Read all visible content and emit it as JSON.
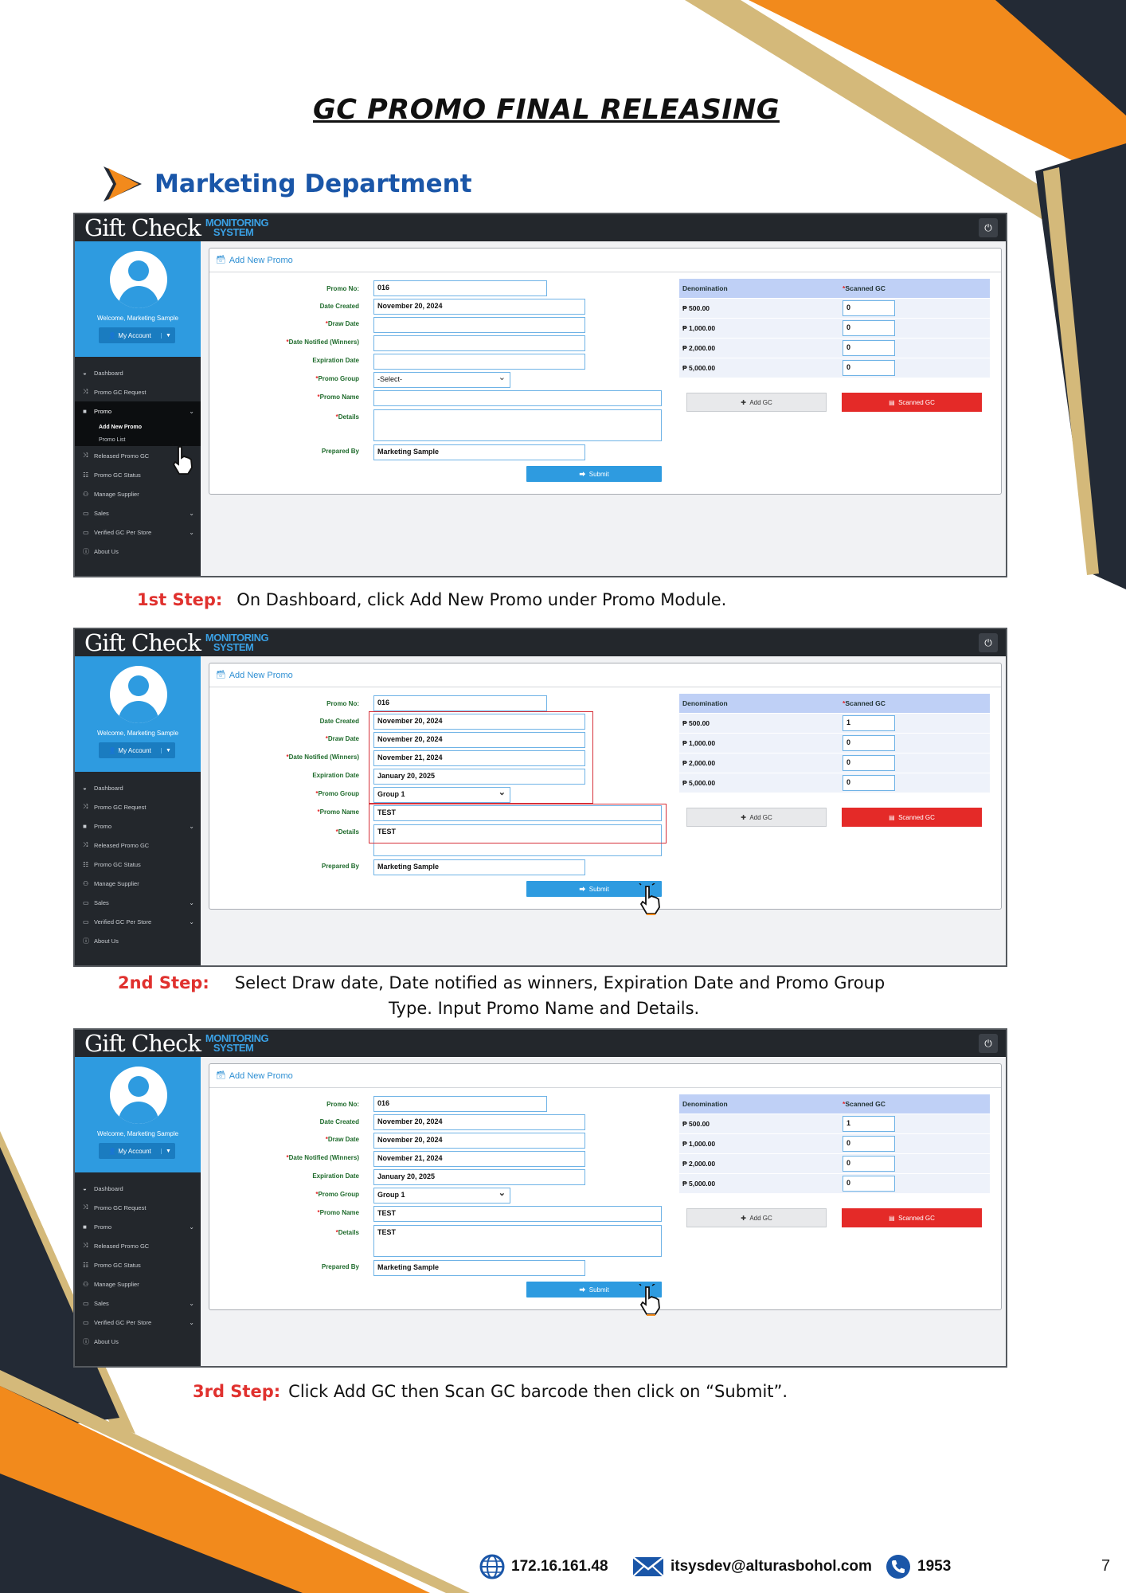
{
  "document": {
    "title": "GC PROMO FINAL RELEASING",
    "section": "Marketing Department",
    "page_number": "7"
  },
  "app": {
    "logo_main": "Gift Check",
    "logo_sub_1": "MONITORING",
    "logo_sub_2": "SYSTEM",
    "welcome": "Welcome, Marketing Sample",
    "account_button": "My Account",
    "panel_title": "Add New Promo",
    "menu": {
      "dashboard": "Dashboard",
      "promo_gc_request": "Promo GC Request",
      "promo": "Promo",
      "add_new_promo": "Add New Promo",
      "promo_list": "Promo List",
      "released_promo_gc": "Released Promo GC",
      "promo_gc_status": "Promo GC Status",
      "manage_supplier": "Manage Supplier",
      "sales": "Sales",
      "verified_gc_per_store": "Verified GC Per Store",
      "about_us": "About Us"
    },
    "labels": {
      "promo_no": "Promo No:",
      "date_created": "Date Created",
      "draw_date": "Draw Date",
      "date_notified": "Date Notified (Winners)",
      "expiration_date": "Expiration Date",
      "promo_group": "Promo Group",
      "promo_name": "Promo Name",
      "details": "Details",
      "prepared_by": "Prepared By",
      "submit": "Submit",
      "denomination": "Denomination",
      "scanned_gc_header": "Scanned GC",
      "add_gc": "Add GC",
      "scanned_gc_button": "Scanned GC"
    },
    "denominations": [
      "₱ 500.00",
      "₱ 1,000.00",
      "₱ 2,000.00",
      "₱ 5,000.00"
    ]
  },
  "screens": [
    {
      "promo_no": "016",
      "date_created": "November 20, 2024",
      "draw_date": "",
      "date_notified": "",
      "expiration_date": "",
      "promo_group": "-Select-",
      "promo_name": "",
      "details": "",
      "prepared_by": "Marketing Sample",
      "scanned": [
        "0",
        "0",
        "0",
        "0"
      ]
    },
    {
      "promo_no": "016",
      "date_created": "November 20, 2024",
      "draw_date": "November 20, 2024",
      "date_notified": "November 21, 2024",
      "expiration_date": "January 20, 2025",
      "promo_group": "Group 1",
      "promo_name": "TEST",
      "details": "TEST",
      "prepared_by": "Marketing Sample",
      "scanned": [
        "1",
        "0",
        "0",
        "0"
      ]
    },
    {
      "promo_no": "016",
      "date_created": "November 20, 2024",
      "draw_date": "November 20, 2024",
      "date_notified": "November 21, 2024",
      "expiration_date": "January 20, 2025",
      "promo_group": "Group 1",
      "promo_name": "TEST",
      "details": "TEST",
      "prepared_by": "Marketing Sample",
      "scanned": [
        "1",
        "0",
        "0",
        "0"
      ]
    }
  ],
  "steps": {
    "step1_label": "1st Step:",
    "step1_text": "On Dashboard, click Add New Promo under Promo Module.",
    "step2_label": "2nd Step:",
    "step2_text_line1": "Select Draw date, Date notified as winners, Expiration Date and Promo Group",
    "step2_text_line2": "Type. Input Promo Name and Details.",
    "step3_label": "3rd Step:",
    "step3_text": "Click Add GC then Scan GC barcode then click on “Submit”."
  },
  "footer": {
    "ip": "172.16.161.48",
    "email": "itsysdev@alturasbohol.com",
    "phone": "1953"
  },
  "colors": {
    "orange": "#f28a1c",
    "navy": "#232a35",
    "gold": "#d4b97a",
    "accent_blue": "#2e9be0",
    "red": "#e42a28",
    "heading_blue": "#1a56a8"
  }
}
